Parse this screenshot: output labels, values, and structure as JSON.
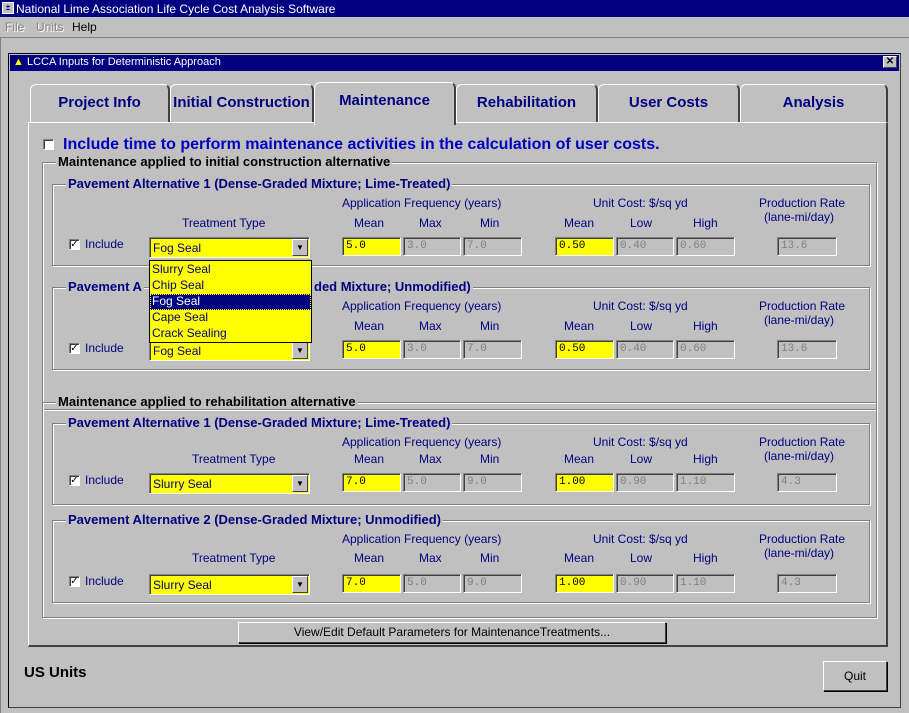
{
  "app": {
    "title": "National Lime Association Life Cycle Cost Analysis Software"
  },
  "menu": {
    "file": "File",
    "units": "Units",
    "help": "Help"
  },
  "window": {
    "title": "LCCA Inputs for Deterministic Approach",
    "close_glyph": "✕"
  },
  "tabs": [
    {
      "label": "Project Info"
    },
    {
      "label": "Initial Construction"
    },
    {
      "label": "Maintenance"
    },
    {
      "label": "Rehabilitation"
    },
    {
      "label": "User Costs"
    },
    {
      "label": "Analysis"
    }
  ],
  "include_time_label": "Include time to perform maintenance activities in the calculation of user costs.",
  "include_time_checked": false,
  "headers": {
    "treatment_type": "Treatment Type",
    "app_freq": "Application Frequency (years)",
    "unit_cost": "Unit Cost: $/sq yd",
    "prod_rate_1": "Production Rate",
    "prod_rate_2": "(lane-mi/day)",
    "mean": "Mean",
    "max": "Max",
    "min": "Min",
    "low": "Low",
    "high": "High",
    "include": "Include"
  },
  "initial": {
    "title": "Maintenance applied to initial construction alternative",
    "alt1": {
      "title": "Pavement Alternative 1 (Dense-Graded Mixture; Lime-Treated)",
      "treatment": "Fog Seal",
      "freq_mean": "5.0",
      "freq_max": "3.0",
      "freq_min": "7.0",
      "cost_mean": "0.50",
      "cost_low": "0.40",
      "cost_high": "0.60",
      "rate": "13.6"
    },
    "alt2": {
      "title_left": "Pavement A",
      "title_right": "ded Mixture; Unmodified)",
      "treatment": "Fog Seal",
      "freq_mean": "5.0",
      "freq_max": "3.0",
      "freq_min": "7.0",
      "cost_mean": "0.50",
      "cost_low": "0.40",
      "cost_high": "0.60",
      "rate": "13.6"
    }
  },
  "rehab": {
    "title": "Maintenance applied to rehabilitation alternative",
    "alt1": {
      "title": "Pavement Alternative 1 (Dense-Graded Mixture; Lime-Treated)",
      "treatment": "Slurry Seal",
      "freq_mean": "7.0",
      "freq_max": "5.0",
      "freq_min": "9.0",
      "cost_mean": "1.00",
      "cost_low": "0.90",
      "cost_high": "1.10",
      "rate": "4.3"
    },
    "alt2": {
      "title": "Pavement Alternative 2 (Dense-Graded Mixture; Unmodified)",
      "treatment": "Slurry Seal",
      "freq_mean": "7.0",
      "freq_max": "5.0",
      "freq_min": "9.0",
      "cost_mean": "1.00",
      "cost_low": "0.90",
      "cost_high": "1.10",
      "rate": "4.3"
    }
  },
  "dropdown": {
    "options": [
      "Slurry Seal",
      "Chip Seal",
      "Fog Seal",
      "Cape Seal",
      "Crack Sealing"
    ],
    "selected": "Fog Seal"
  },
  "buttons": {
    "view_edit": "View/Edit Default Parameters for MaintenanceTreatments...",
    "quit": "Quit"
  },
  "units_label": "US Units",
  "colors": {
    "title_bar": "#000080",
    "highlight_field": "#ffff00",
    "label_text": "#000080",
    "face": "#c0c0c0"
  }
}
